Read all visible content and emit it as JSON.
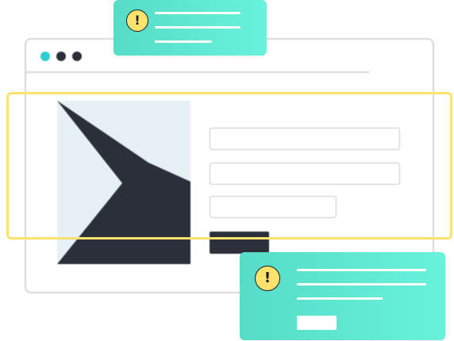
{
  "theme": {
    "accent_teal": "#2ccfd0",
    "dark_navy": "#2b2f3a",
    "hero_background": "#e6f1f6",
    "alert_gradient_start": "#56dcc7",
    "alert_gradient_end": "#68f2dc",
    "warning_yellow": "#fde36d",
    "frame_grey": "#d7d7d9"
  },
  "browser": {
    "window_controls": [
      {
        "name": "close",
        "color": "#2ccfd0"
      },
      {
        "name": "minimize",
        "color": "#2b2f3a"
      },
      {
        "name": "maximize",
        "color": "#2b2f3a"
      }
    ]
  },
  "alerts": [
    {
      "icon": "warning-icon",
      "glyph": "!",
      "has_button": false
    },
    {
      "icon": "warning-icon",
      "glyph": "!",
      "has_button": true
    }
  ]
}
